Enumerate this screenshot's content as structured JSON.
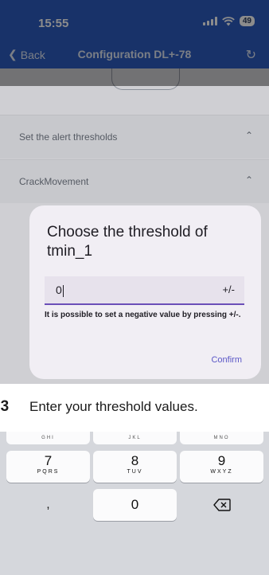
{
  "status_bar": {
    "time": "15:55",
    "battery": "49"
  },
  "nav": {
    "back_label": "Back",
    "title": "Configuration DL+-78"
  },
  "sections": [
    {
      "label": "Set the alert thresholds"
    },
    {
      "label": "CrackMovement"
    }
  ],
  "modal": {
    "title": "Choose the threshold of tmin_1",
    "input_value": "0",
    "sign_toggle": "+/-",
    "hint": "It is possible to set a negative value by pressing +/-.",
    "confirm_label": "Confirm"
  },
  "banner": {
    "step": "03",
    "text": "Enter your threshold values."
  },
  "keyboard": {
    "ghost_row": [
      "GHI",
      "JKL",
      "MNO"
    ],
    "row3": [
      {
        "digit": "7",
        "letters": "PQRS"
      },
      {
        "digit": "8",
        "letters": "TUV"
      },
      {
        "digit": "9",
        "letters": "WXYZ"
      }
    ],
    "row4": {
      "left": ",",
      "zero": "0"
    }
  },
  "icons": [
    "chevron-left-icon",
    "refresh-icon",
    "chevron-up-icon",
    "backspace-icon",
    "wifi-icon",
    "signal-icon",
    "battery-icon"
  ]
}
